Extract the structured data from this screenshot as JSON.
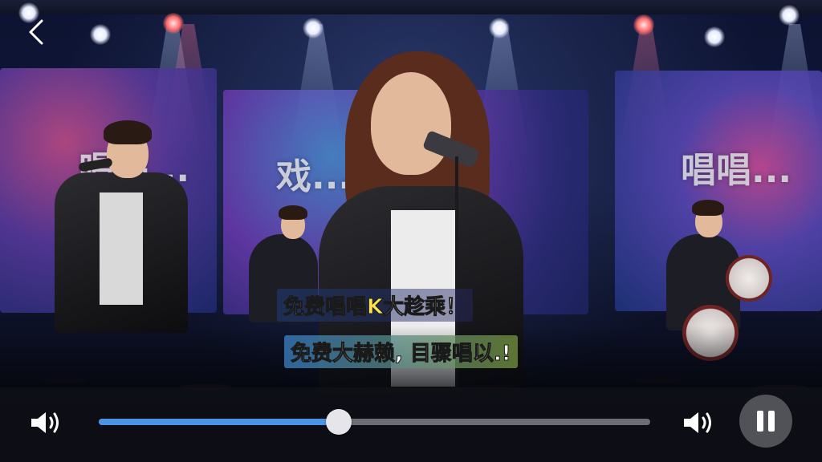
{
  "screens": {
    "left_text": "唱唱...",
    "center_text": "戏...",
    "right_text": "唱唱..."
  },
  "captions": {
    "line1_prefix": "免费",
    "line1_highlight": "唱唱K",
    "line1_suffix": "大趁乘！",
    "line2": "免费大赫赖, 目骤唱以.!"
  },
  "player": {
    "progress": 0.435,
    "state": "playing",
    "icons": {
      "back": "chevron-left-icon",
      "volume_left": "speaker-icon",
      "volume_right": "speaker-icon",
      "pause": "pause-icon"
    },
    "accent": "#4b95e6"
  }
}
